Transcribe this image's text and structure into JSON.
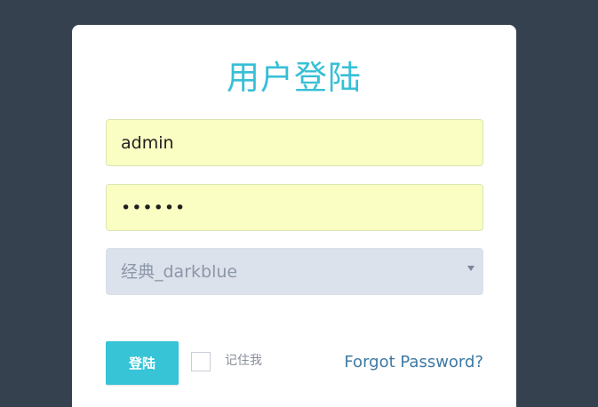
{
  "login": {
    "title": "用户登陆",
    "username_value": "admin",
    "password_value": "••••••",
    "theme_select_value": "经典_darkblue",
    "login_button_label": "登陆",
    "remember_label": "记住我",
    "forgot_link": "Forgot Password?"
  },
  "icons": {
    "select_arrow": "chevron-down-icon"
  },
  "colors": {
    "background": "#36414f",
    "title": "#36bfd6",
    "input_fill": "#fafec2",
    "select_fill": "#dce2ec",
    "button": "#36c4d6",
    "link": "#3f79a3"
  }
}
